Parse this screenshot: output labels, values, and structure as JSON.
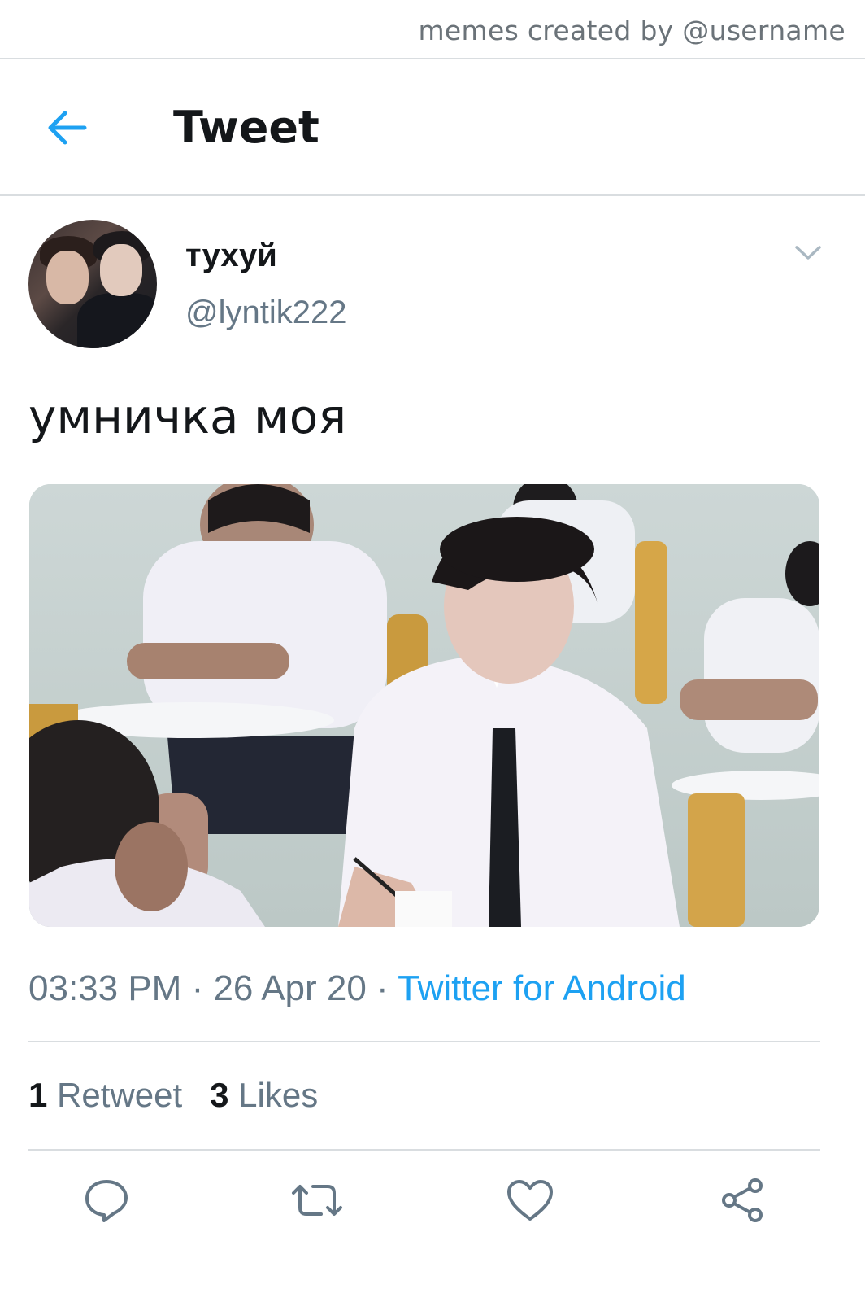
{
  "watermark": "memes created by @username",
  "header": {
    "title": "Tweet",
    "back_icon": "arrow-left-icon"
  },
  "tweet": {
    "author": {
      "name": "тухуй",
      "handle": "@lyntik222"
    },
    "text": "умничка моя",
    "time": "03:33 PM",
    "date": "26 Apr 20",
    "separator": " · ",
    "source": "Twitter for Android",
    "stats": {
      "retweets_count": "1",
      "retweets_label": "Retweet",
      "likes_count": "3",
      "likes_label": "Likes"
    }
  },
  "actions": [
    "reply-icon",
    "retweet-icon",
    "like-icon",
    "share-icon"
  ],
  "colors": {
    "accent": "#1da1f2",
    "secondary_text": "#657786",
    "primary_text": "#14171a",
    "divider": "#d9dde0"
  }
}
